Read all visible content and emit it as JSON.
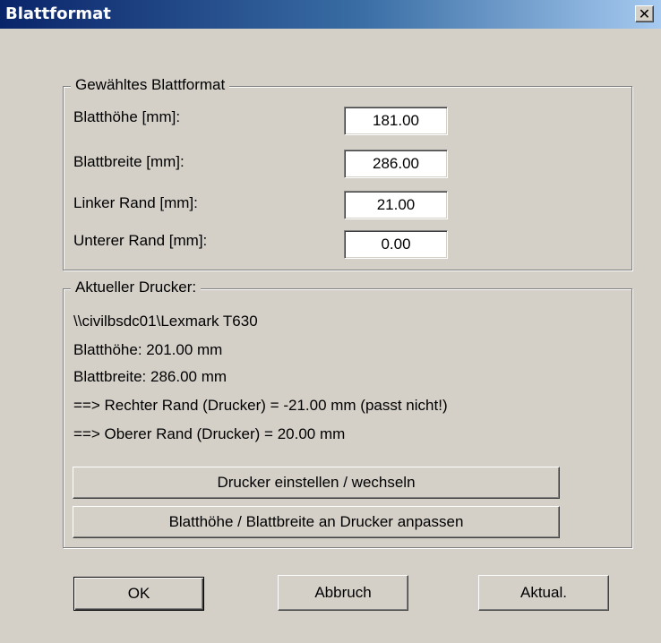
{
  "window": {
    "title": "Blattformat"
  },
  "format_group": {
    "legend": "Gewähltes Blattformat",
    "rows": [
      {
        "label": "Blatthöhe [mm]:",
        "value": "181.00"
      },
      {
        "label": "Blattbreite [mm]:",
        "value": "286.00"
      },
      {
        "label": "Linker Rand [mm]:",
        "value": "21.00"
      },
      {
        "label": "Unterer Rand [mm]:",
        "value": "0.00"
      }
    ]
  },
  "printer_group": {
    "legend": "Aktueller Drucker:",
    "lines": [
      "\\\\civilbsdc01\\Lexmark T630",
      "Blatthöhe:  201.00 mm",
      "Blattbreite: 286.00 mm",
      "==> Rechter Rand (Drucker) = -21.00 mm  (passt nicht!)",
      "==> Oberer Rand (Drucker) = 20.00 mm"
    ],
    "setup_button": "Drucker einstellen / wechseln",
    "adapt_button": "Blatthöhe / Blattbreite an Drucker anpassen"
  },
  "buttons": {
    "ok": "OK",
    "cancel": "Abbruch",
    "update": "Aktual."
  },
  "icons": {
    "close": "close-icon"
  }
}
